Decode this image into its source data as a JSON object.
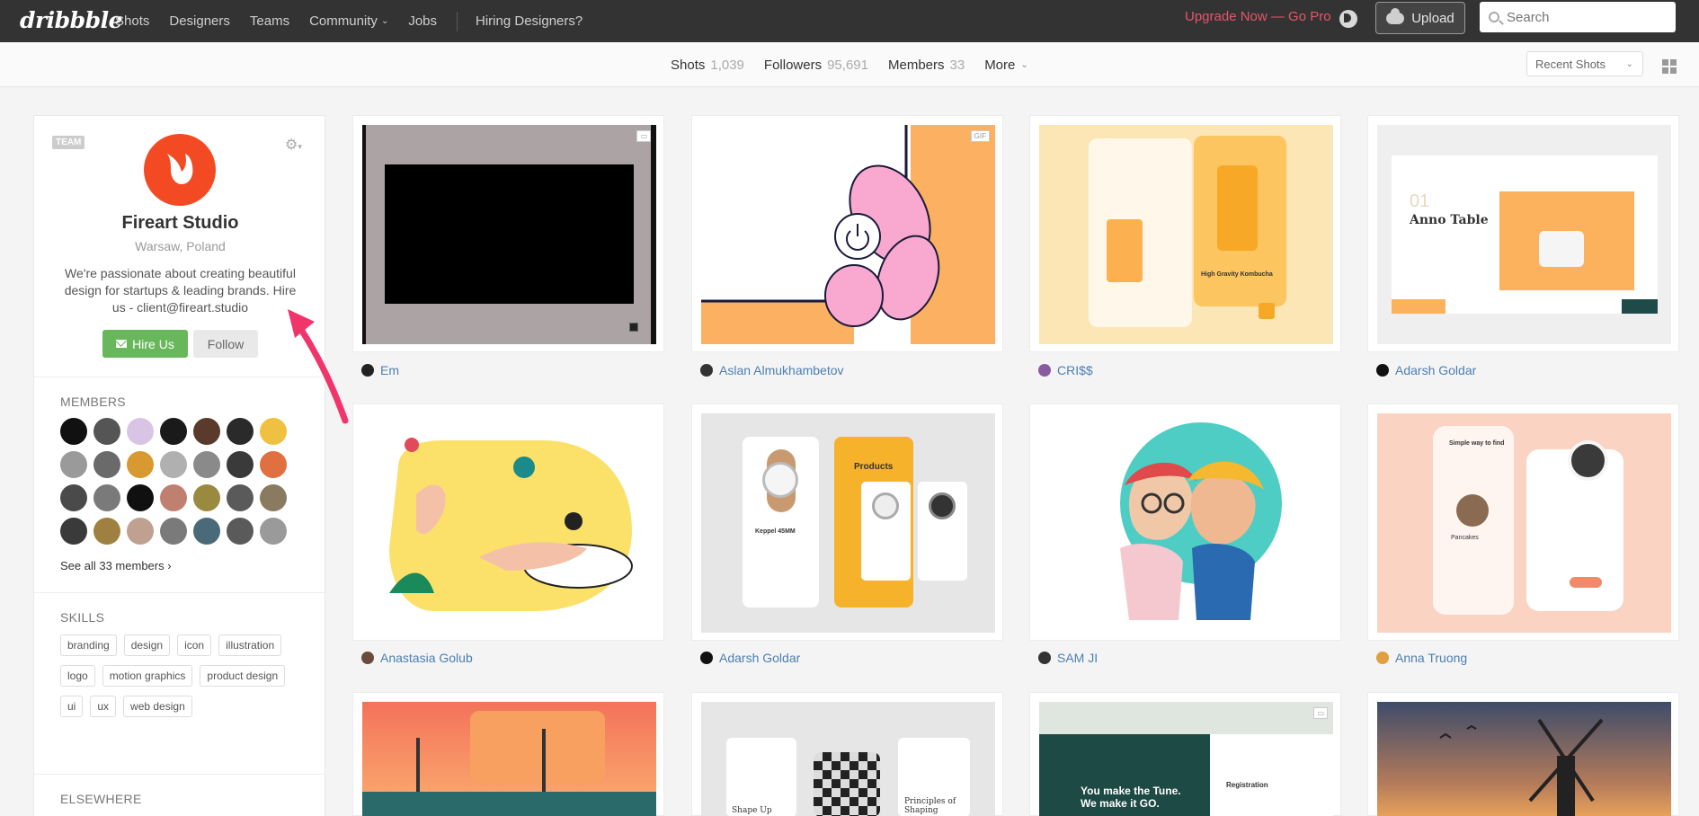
{
  "nav": {
    "logo": "dribbble",
    "links": [
      "Shots",
      "Designers",
      "Teams",
      "Community",
      "Jobs"
    ],
    "hiring": "Hiring Designers?",
    "upgrade": "Upgrade Now — Go Pro",
    "upload": "Upload",
    "search_placeholder": "Search"
  },
  "subnav": {
    "tabs": [
      {
        "label": "Shots",
        "count": "1,039"
      },
      {
        "label": "Followers",
        "count": "95,691"
      },
      {
        "label": "Members",
        "count": "33"
      },
      {
        "label": "More",
        "count": ""
      }
    ],
    "sort": "Recent Shots"
  },
  "profile": {
    "badge": "TEAM",
    "name": "Fireart Studio",
    "location": "Warsaw, Poland",
    "bio": "We're passionate about creating beautiful design for startups & leading brands. Hire us - client@fireart.studio",
    "hire": "Hire Us",
    "follow": "Follow",
    "brand_color": "#f34a24"
  },
  "members": {
    "title": "MEMBERS",
    "see_all": "See all 33 members ›",
    "avatar_colors": [
      "#111111",
      "#555555",
      "#d9c4e6",
      "#1a1a1a",
      "#5a3a2a",
      "#2a2a2a",
      "#f0c040",
      "#9a9a9a",
      "#6a6a6a",
      "#d89a30",
      "#b0b0b0",
      "#8a8a8a",
      "#3a3a3a",
      "#e07040",
      "#4a4a4a",
      "#7a7a7a",
      "#101010",
      "#c08070",
      "#9a8a40",
      "#5a5a5a",
      "#8a7a60",
      "#3a3a3a",
      "#a08040",
      "#c0a090",
      "#7a7a7a",
      "#4a6a7a",
      "#5a5a5a",
      "#9a9a9a"
    ]
  },
  "skills": {
    "title": "SKILLS",
    "items": [
      "branding",
      "design",
      "icon",
      "illustration",
      "logo",
      "motion graphics",
      "product design",
      "ui",
      "ux",
      "web design"
    ]
  },
  "elsewhere": {
    "title": "ELSEWHERE"
  },
  "shots": [
    {
      "author": "Em",
      "badge": "▭",
      "bg": "#aca4a4",
      "av": "#222"
    },
    {
      "author": "Aslan Almukhambetov",
      "badge": "GIF",
      "bg": "#ffffff",
      "av": "#333"
    },
    {
      "author": "CRI$$",
      "badge": "",
      "bg": "#fce6b5",
      "av": "#8a5aa0"
    },
    {
      "author": "Adarsh Goldar",
      "badge": "",
      "bg": "#efefef",
      "av": "#111"
    },
    {
      "author": "Anastasia Golub",
      "badge": "",
      "bg": "#ffffff",
      "av": "#6a4a3a"
    },
    {
      "author": "Adarsh Goldar",
      "badge": "",
      "bg": "#e6e6e6",
      "av": "#111"
    },
    {
      "author": "SAM JI",
      "badge": "",
      "bg": "#ffffff",
      "av": "#333"
    },
    {
      "author": "Anna Truong",
      "badge": "",
      "bg": "#fbd3c2",
      "av": "#e0a040"
    },
    {
      "author": "",
      "badge": "",
      "bg": "#f08a5a",
      "av": "#333"
    },
    {
      "author": "",
      "badge": "",
      "bg": "#e6e6e6",
      "av": "#333"
    },
    {
      "author": "",
      "badge": "▭",
      "bg": "#dfe6e0",
      "av": "#333"
    },
    {
      "author": "",
      "badge": "",
      "bg": "#3e4c6a",
      "av": "#333"
    }
  ],
  "shot_texts": {
    "anno_table": "Anno Table",
    "anno_num": "01",
    "products": "Products",
    "keppel": "Keppel 45MM",
    "kombucha": "High Gravity Kombucha",
    "simple_way": "Simple way to find",
    "pancakes": "Pancakes",
    "shape_up": "Shape Up",
    "principles": "Principles of Shaping",
    "tune": "You make the Tune. We make it GO.",
    "registration": "Registration"
  }
}
